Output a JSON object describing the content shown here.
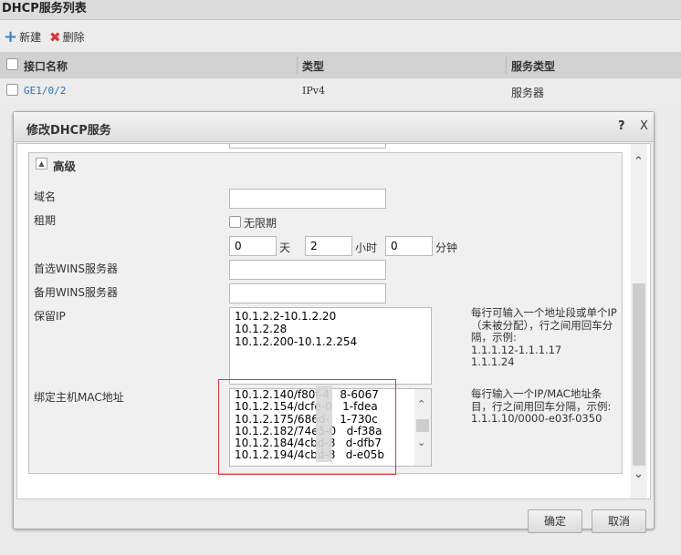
{
  "page_title": "DHCP服务列表",
  "toolbar": {
    "new_label": "新建",
    "delete_label": "删除"
  },
  "table": {
    "headers": [
      "接口名称",
      "类型",
      "服务类型"
    ],
    "rows": [
      {
        "interface": "GE1/0/2",
        "type": "IPv4",
        "service_type": "服务器"
      }
    ]
  },
  "dialog": {
    "title": "修改DHCP服务",
    "help": "?",
    "close": "X",
    "section_title": "高级",
    "domain_label": "域名",
    "domain_value": "",
    "lease_label": "租期",
    "unlimited_label": "无限期",
    "lease_days": "0",
    "days_unit": "天",
    "lease_hours": "2",
    "hours_unit": "小时",
    "lease_minutes": "0",
    "minutes_unit": "分钟",
    "wins_primary_label": "首选WINS服务器",
    "wins_primary_value": "",
    "wins_backup_label": "备用WINS服务器",
    "wins_backup_value": "",
    "reserved_ip_label": "保留IP",
    "reserved_ip_value": "10.1.2.2-10.1.2.20\n10.1.2.28\n10.1.2.200-10.1.2.254",
    "reserved_ip_hint": "每行可输入一个地址段或单个IP（未被分配），行之间用回车分隔，示例:\n1.1.1.12-1.1.1.17\n1.1.1.24",
    "bind_mac_label": "绑定主机MAC地址",
    "bind_mac_value": "10.1.2.140/f80f-4   8-6067\n10.1.2.154/dcfe-0   1-fdea\n10.1.2.175/686d-   1-730c\n10.1.2.182/74e5-0   d-f38a\n10.1.2.184/4cbd-8   d-dfb7\n10.1.2.194/4cbd-8   d-e05b",
    "bind_mac_hint": "每行输入一个IP/MAC地址条目，行之间用回车分隔，示例:\n1.1.1.10/0000-e03f-0350",
    "ok_label": "确定",
    "cancel_label": "取消"
  },
  "colors": {
    "link": "#2a6ebb",
    "highlight": "#d9363e"
  }
}
